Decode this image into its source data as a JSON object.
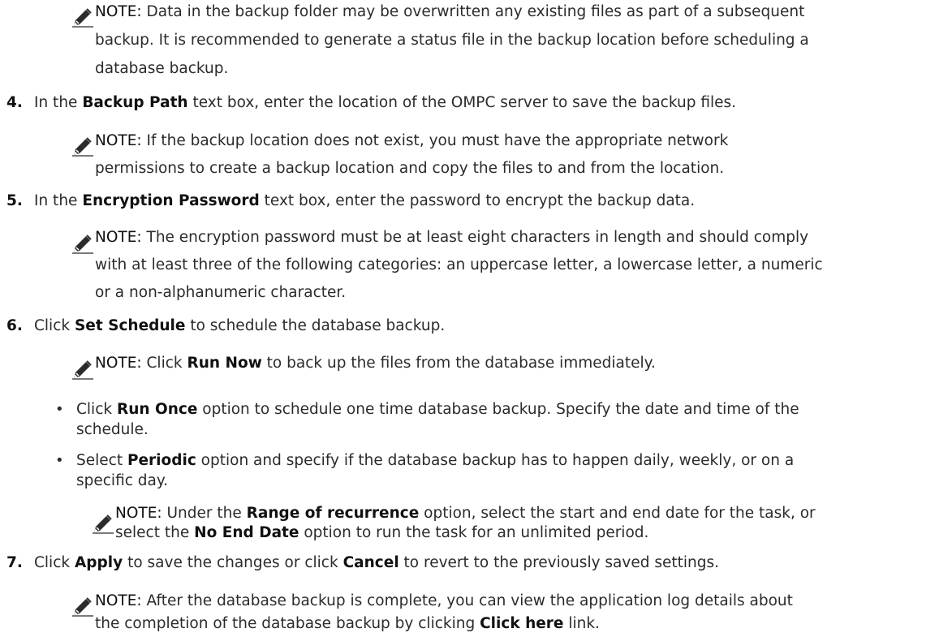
{
  "note_label": "NOTE:",
  "icons": {
    "note": "pencil-note-icon"
  },
  "notes": {
    "n1": {
      "l1": "Data in the backup folder may be overwritten any existing files as part of a subsequent",
      "l2": "backup. It is recommended to generate a status file in the backup location before scheduling a",
      "l3": "database backup."
    },
    "n2": {
      "l1": "If the backup location does not exist, you must have the appropriate network",
      "l2": "permissions to create a backup location and copy the files to and from the location."
    },
    "n3": {
      "l1": "The encryption password must be at least eight characters in length and should comply",
      "l2": "with at least three of the following categories: an uppercase letter, a lowercase letter, a numeric",
      "l3": "or a non-alphanumeric character."
    },
    "n4": {
      "pre": "Click ",
      "b1": "Run Now",
      "post": " to back up the files from the database immediately."
    },
    "n5": {
      "l1_pre": "Under the ",
      "l1_b": "Range of recurrence",
      "l1_post": " option, select the start and end date for the task, or",
      "l2_pre": "select the ",
      "l2_b": "No End Date",
      "l2_post": " option to run the task for an unlimited period."
    },
    "n6": {
      "l1": "After the database backup is complete, you can view the application log details about",
      "l2_pre": "the completion of the database backup by clicking ",
      "l2_b": "Click here",
      "l2_post": " link."
    }
  },
  "steps": {
    "s4": {
      "num": "4.",
      "pre": "In the ",
      "b": "Backup Path",
      "post": " text box, enter the location of the OMPC server to save the backup files."
    },
    "s5": {
      "num": "5.",
      "pre": "In the ",
      "b": "Encryption Password",
      "post": " text box, enter the password to encrypt the backup data."
    },
    "s6": {
      "num": "6.",
      "pre": "Click ",
      "b": "Set Schedule",
      "post": " to schedule the database backup."
    },
    "s7": {
      "num": "7.",
      "pre": "Click ",
      "b1": "Apply",
      "mid": " to save the changes or click ",
      "b2": "Cancel",
      "post": " to revert to the previously saved settings."
    }
  },
  "bullets": {
    "b1": {
      "pre": "Click ",
      "b": "Run Once",
      "post1": " option to schedule one time database backup. Specify the date and time of the",
      "l2": "schedule."
    },
    "b2": {
      "pre": "Select ",
      "b": "Periodic",
      "post1": " option and specify if the database backup has to happen daily, weekly, or on a",
      "l2": "specific day."
    }
  }
}
